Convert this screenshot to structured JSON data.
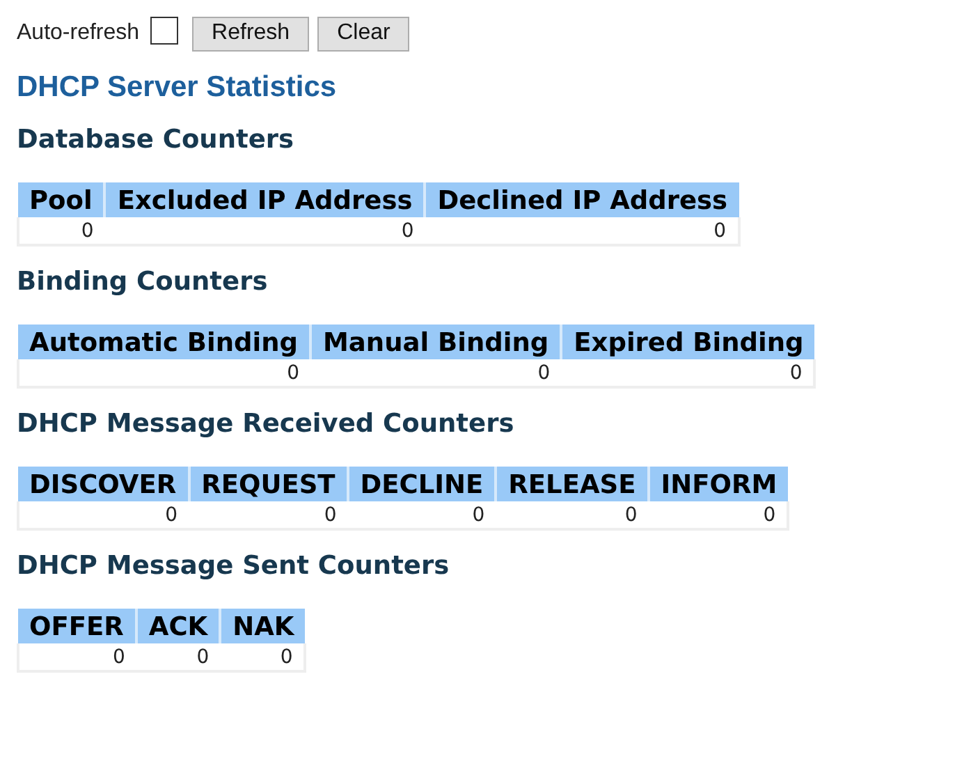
{
  "toolbar": {
    "auto_refresh": {
      "label": "Auto-refresh",
      "checked": false
    },
    "buttons": [
      "Refresh",
      "Clear"
    ]
  },
  "title": "DHCP Server Statistics",
  "sections": [
    {
      "heading": "Database Counters",
      "columns": [
        "Pool",
        "Excluded IP Address",
        "Declined IP Address"
      ],
      "values": [
        "0",
        "0",
        "0"
      ]
    },
    {
      "heading": "Binding Counters",
      "columns": [
        "Automatic Binding",
        "Manual Binding",
        "Expired Binding"
      ],
      "values": [
        "0",
        "0",
        "0"
      ]
    },
    {
      "heading": "DHCP Message Received Counters",
      "columns": [
        "DISCOVER",
        "REQUEST",
        "DECLINE",
        "RELEASE",
        "INFORM"
      ],
      "values": [
        "0",
        "0",
        "0",
        "0",
        "0"
      ]
    },
    {
      "heading": "DHCP Message Sent Counters",
      "columns": [
        "OFFER",
        "ACK",
        "NAK"
      ],
      "values": [
        "0",
        "0",
        "0"
      ]
    }
  ]
}
